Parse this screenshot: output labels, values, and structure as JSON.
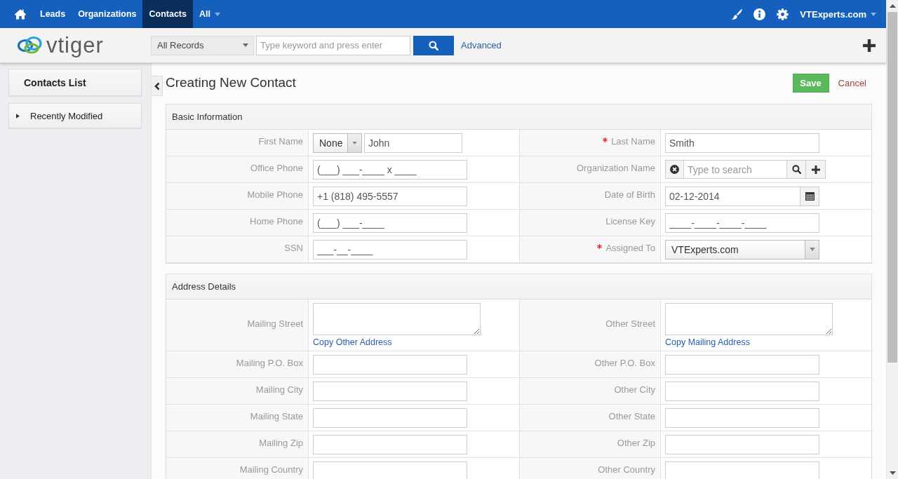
{
  "top_nav": {
    "items": [
      {
        "kind": "home",
        "selected": false
      },
      {
        "kind": "link",
        "label": "Leads",
        "selected": false
      },
      {
        "kind": "link",
        "label": "Organizations",
        "selected": false
      },
      {
        "kind": "link",
        "label": "Contacts",
        "selected": true
      },
      {
        "kind": "menu",
        "label": "All",
        "selected": false
      }
    ]
  },
  "user_menu": {
    "label": "VTExperts.com"
  },
  "header": {
    "logo": "vtiger",
    "search": {
      "filter": "All Records",
      "placeholder": "Type keyword and press enter"
    },
    "advanced": "Advanced"
  },
  "sidebar": {
    "title": "Contacts List",
    "items": [
      {
        "label": "Recently Modified",
        "expanded": false
      }
    ]
  },
  "form": {
    "title": "Creating New Contact",
    "save": "Save",
    "cancel": "Cancel",
    "blocks": [
      {
        "title": "Basic Information",
        "rows": [
          [
            {
              "label": "First Name",
              "required": false,
              "kind": "salutation",
              "option": "None",
              "value": "John"
            },
            {
              "label": "Last Name",
              "required": true,
              "kind": "text",
              "value": "Smith"
            }
          ],
          [
            {
              "label": "Office Phone",
              "required": false,
              "kind": "text",
              "value": "(___) ___-____ x ____"
            },
            {
              "label": "Organization Name",
              "required": false,
              "kind": "reference",
              "placeholder": "Type to search"
            }
          ],
          [
            {
              "label": "Mobile Phone",
              "required": false,
              "kind": "text",
              "value": "+1 (818) 495-5557"
            },
            {
              "label": "Date of Birth",
              "required": false,
              "kind": "date",
              "value": "02-12-2014"
            }
          ],
          [
            {
              "label": "Home Phone",
              "required": false,
              "kind": "text",
              "value": "(___) ___-____"
            },
            {
              "label": "License Key",
              "required": false,
              "kind": "text",
              "value": "____-____-____-____"
            }
          ],
          [
            {
              "label": "SSN",
              "required": false,
              "kind": "text",
              "value": "___-__-____"
            },
            {
              "label": "Assigned To",
              "required": true,
              "kind": "picklist",
              "value": "VTExperts.com"
            }
          ]
        ]
      },
      {
        "title": "Address Details",
        "rows": [
          [
            {
              "label": "Mailing Street",
              "required": false,
              "kind": "textarea",
              "link": "Copy Other Address"
            },
            {
              "label": "Other Street",
              "required": false,
              "kind": "textarea",
              "link": "Copy Mailing Address"
            }
          ],
          [
            {
              "label": "Mailing P.O. Box",
              "required": false,
              "kind": "text"
            },
            {
              "label": "Other P.O. Box",
              "required": false,
              "kind": "text"
            }
          ],
          [
            {
              "label": "Mailing City",
              "required": false,
              "kind": "text"
            },
            {
              "label": "Other City",
              "required": false,
              "kind": "text"
            }
          ],
          [
            {
              "label": "Mailing State",
              "required": false,
              "kind": "text"
            },
            {
              "label": "Other State",
              "required": false,
              "kind": "text"
            }
          ],
          [
            {
              "label": "Mailing Zip",
              "required": false,
              "kind": "text"
            },
            {
              "label": "Other Zip",
              "required": false,
              "kind": "text"
            }
          ],
          [
            {
              "label": "Mailing Country",
              "required": false,
              "kind": "text"
            },
            {
              "label": "Other Country",
              "required": false,
              "kind": "text"
            }
          ]
        ]
      }
    ]
  }
}
